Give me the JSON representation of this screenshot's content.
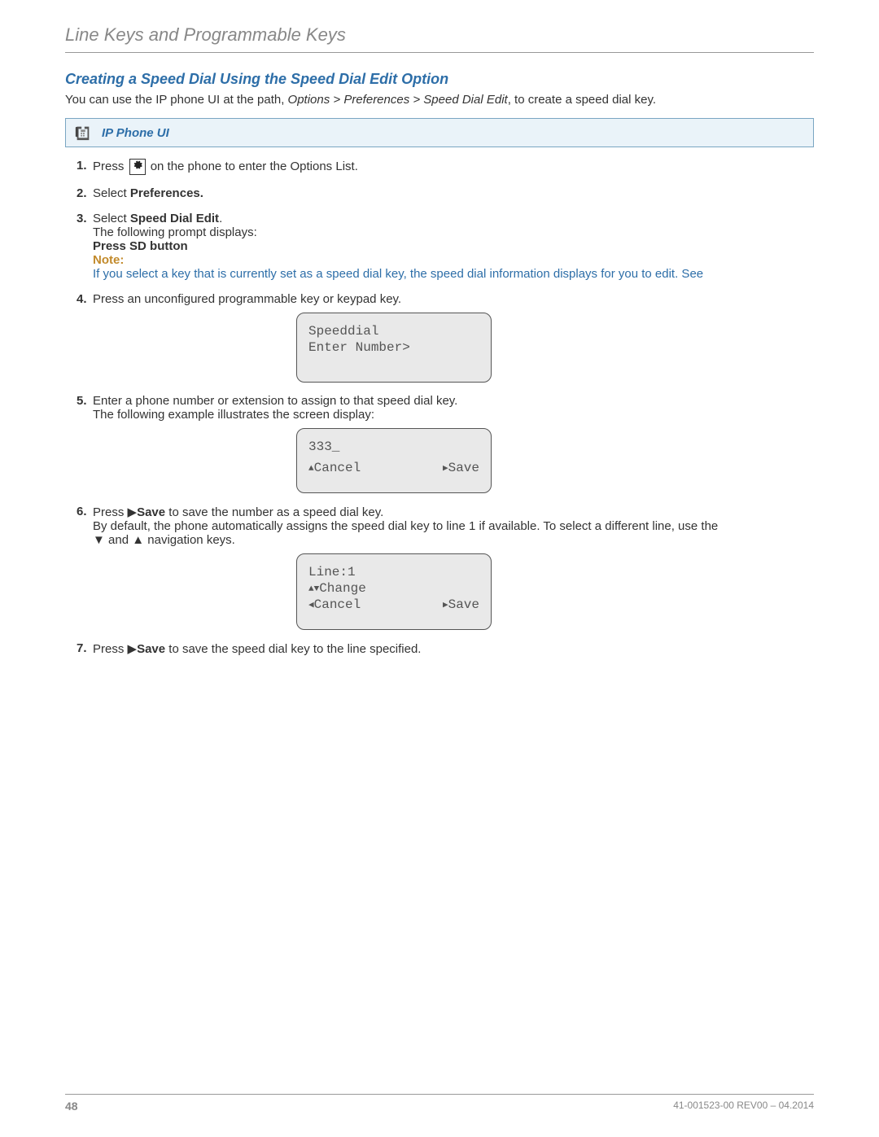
{
  "section_title": "Line Keys and Programmable Keys",
  "heading": "Creating a Speed Dial Using the Speed Dial Edit Option",
  "intro_pre": "You can use the IP phone UI at the path, ",
  "intro_path": "Options > Preferences > Speed Dial Edit",
  "intro_post": ", to create a speed dial key.",
  "ui_box_label": "IP Phone UI",
  "steps": {
    "s1_pre": "Press ",
    "s1_post": " on the phone to enter the Options List.",
    "s2_pre": "Select ",
    "s2_bold": "Preferences.",
    "s3_pre": "Select ",
    "s3_bold": "Speed Dial Edit",
    "s3_period": ".",
    "s3_line2": "The following prompt displays:",
    "s3_prompt": "Press SD button",
    "s3_note_label": "Note:",
    "s3_note_text": "If you select a key that is currently set as a speed dial key, the speed dial information displays for you to edit. See",
    "s4": "Press an unconfigured programmable key or keypad key.",
    "lcd1_l1": "Speeddial",
    "lcd1_l2": "Enter Number>",
    "s5_l1": "Enter a phone number or extension to assign to that speed dial key.",
    "s5_l2": "The following example illustrates the screen display:",
    "lcd2_l1": "333_",
    "lcd2_cancel": "Cancel",
    "lcd2_save": "Save",
    "s6_pre": "Press ",
    "s6_save": "Save",
    "s6_post": " to save the number as a speed dial key.",
    "s6_l2": "By default, the phone automatically assigns the speed dial key to line 1 if available. To select a different line, use the",
    "s6_l3_mid": " and ",
    "s6_l3_post": " navigation keys.",
    "lcd3_l1": "Line:1",
    "lcd3_change": "Change",
    "lcd3_cancel": "Cancel",
    "lcd3_save": "Save",
    "s7_pre": "Press ",
    "s7_save": "Save",
    "s7_post": " to save the speed dial key to the line specified."
  },
  "footer": {
    "page": "48",
    "docid": "41-001523-00 REV00 – 04.2014"
  }
}
